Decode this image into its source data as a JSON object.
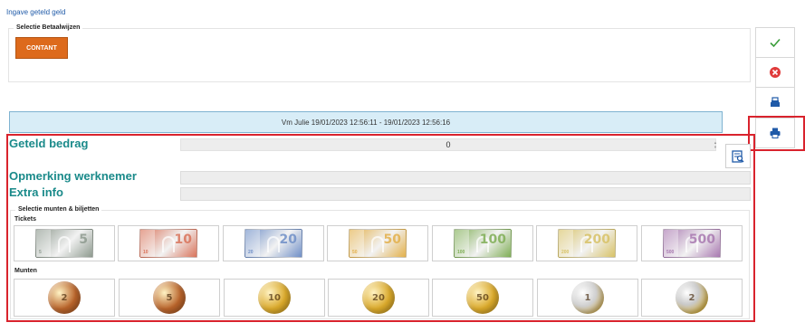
{
  "page": {
    "title": "Ingave geteld geld"
  },
  "payment_methods": {
    "legend": "Selectie Betaalwijzen",
    "cash_label": "CONTANT"
  },
  "toolbar": {
    "icons": [
      "check-icon",
      "cancel-icon",
      "cash-register-icon",
      "print-icon"
    ],
    "colors": {
      "check": "#3a9d3a",
      "cancel": "#e03a3a",
      "icon": "#1f5aa8",
      "highlight": "#d9232d"
    }
  },
  "session": {
    "info": "Vm Julie 19/01/2023 12:56:11 - 19/01/2023 12:56:16"
  },
  "form": {
    "counted_label": "Geteld bedrag",
    "counted_value": "0",
    "remark_label": "Opmerking werknemer",
    "extra_label": "Extra info"
  },
  "selection": {
    "legend": "Selectie munten & biljetten",
    "tickets_label": "Tickets",
    "coins_label": "Munten",
    "notes": [
      {
        "value": "5",
        "color": "#8e9a8f"
      },
      {
        "value": "10",
        "color": "#d9735a"
      },
      {
        "value": "20",
        "color": "#6f8fc7"
      },
      {
        "value": "50",
        "color": "#e3b04a"
      },
      {
        "value": "100",
        "color": "#7fae55"
      },
      {
        "value": "200",
        "color": "#d8c266"
      },
      {
        "value": "500",
        "color": "#a878b0"
      }
    ],
    "coins": [
      {
        "value": "2",
        "color": "#b8632a"
      },
      {
        "value": "5",
        "color": "#b8632a"
      },
      {
        "value": "10",
        "color": "#d9a82a"
      },
      {
        "value": "20",
        "color": "#d9a82a"
      },
      {
        "value": "50",
        "color": "#d9a82a"
      },
      {
        "value": "1",
        "color": "#d6b86a"
      },
      {
        "value": "2",
        "color": "#c9c9c9"
      }
    ]
  }
}
